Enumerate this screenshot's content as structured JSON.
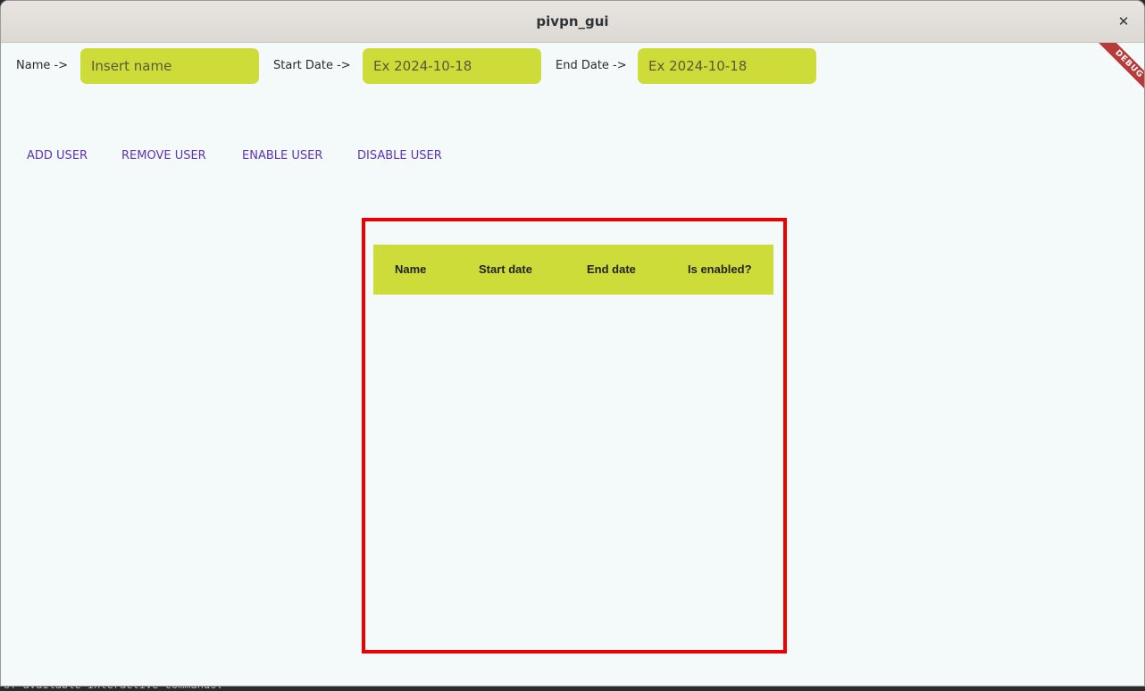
{
  "window": {
    "title": "pivpn_gui",
    "close_symbol": "✕",
    "debug_banner": "DEBUG"
  },
  "form": {
    "name_label": "Name ->",
    "name_placeholder": "Insert name",
    "start_label": "Start Date ->",
    "start_placeholder": "Ex 2024-10-18",
    "end_label": "End Date ->",
    "end_placeholder": "Ex 2024-10-18"
  },
  "actions": {
    "add": "ADD USER",
    "remove": "REMOVE USER",
    "enable": "ENABLE USER",
    "disable": "DISABLE USER"
  },
  "table": {
    "columns": [
      "Name",
      "Start date",
      "End date",
      "Is enabled?"
    ],
    "rows": []
  },
  "background_terminal": {
    "text": "of available interactive commands:"
  },
  "colors": {
    "accent": "#cddc39",
    "button_text": "#5e35b1",
    "frame": "#ee0000",
    "debug": "#b83a3a"
  },
  "icons": {
    "close": "close-icon"
  }
}
